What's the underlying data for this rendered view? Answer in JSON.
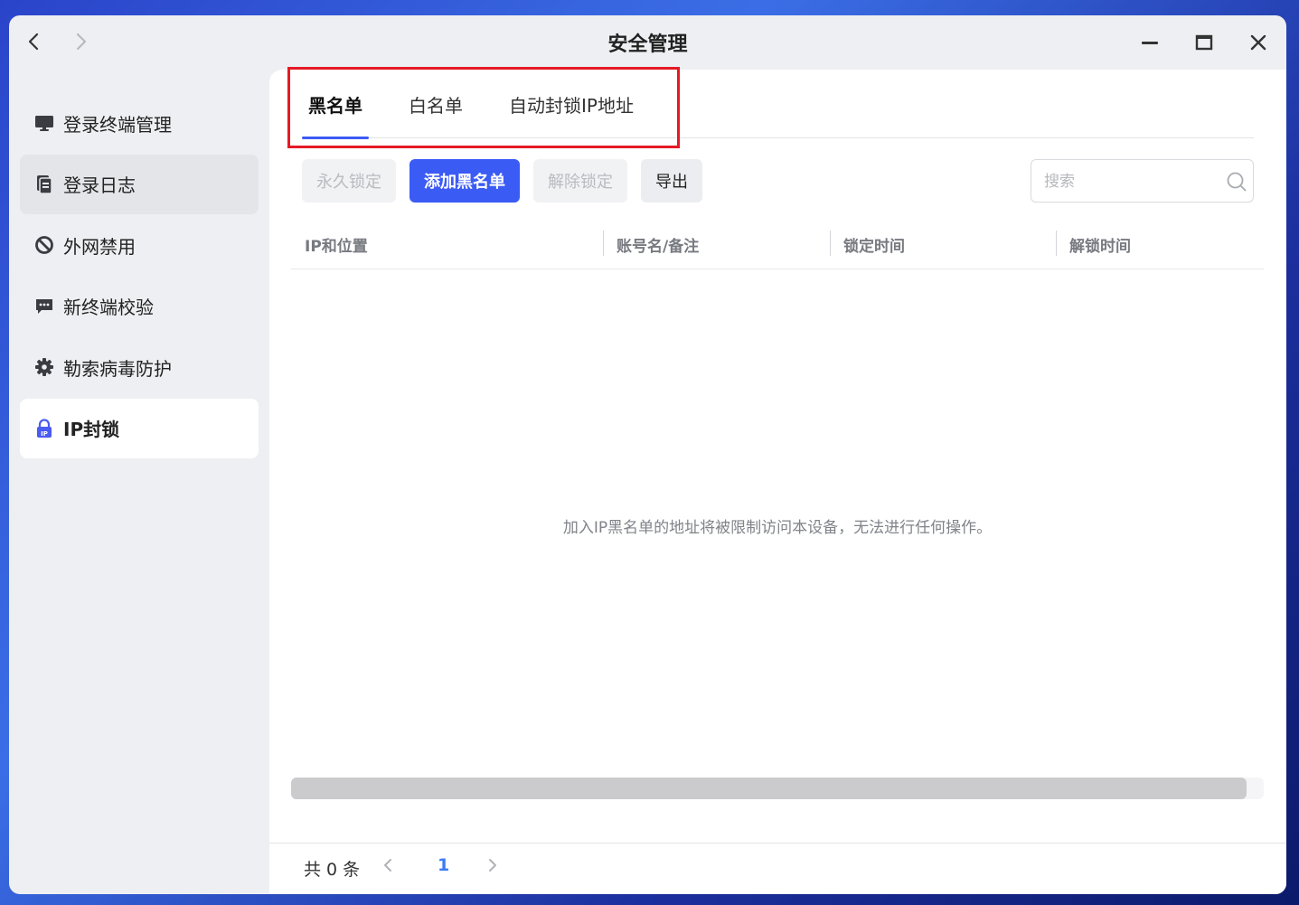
{
  "window": {
    "title": "安全管理",
    "back_icon": "chevron-left-icon",
    "forward_icon": "chevron-right-icon",
    "controls": [
      "minimize-icon",
      "maximize-icon",
      "close-icon"
    ]
  },
  "sidebar": {
    "items": [
      {
        "label": "登录终端管理",
        "icon": "monitor-icon",
        "state": "normal"
      },
      {
        "label": "登录日志",
        "icon": "document-icon",
        "state": "hover"
      },
      {
        "label": "外网禁用",
        "icon": "ban-icon",
        "state": "normal"
      },
      {
        "label": "新终端校验",
        "icon": "chat-icon",
        "state": "normal"
      },
      {
        "label": "勒索病毒防护",
        "icon": "gear-icon",
        "state": "normal"
      },
      {
        "label": "IP封锁",
        "icon": "ip-lock-icon",
        "state": "active"
      }
    ]
  },
  "tabs": [
    {
      "label": "黑名单",
      "active": true
    },
    {
      "label": "白名单",
      "active": false
    },
    {
      "label": "自动封锁IP地址",
      "active": false
    }
  ],
  "toolbar": {
    "permanent_lock": "永久锁定",
    "add_blacklist": "添加黑名单",
    "unlock": "解除锁定",
    "export": "导出",
    "search_placeholder": "搜索"
  },
  "table": {
    "columns": [
      "IP和位置",
      "账号名/备注",
      "锁定时间",
      "解锁时间"
    ],
    "rows": [],
    "empty_message": "加入IP黑名单的地址将被限制访问本设备，无法进行任何操作。"
  },
  "pagination": {
    "total_label": "共 0 条",
    "current_page": "1"
  },
  "colors": {
    "accent": "#3b5bf5",
    "highlight_border": "#e51a24",
    "page_number": "#3b7cf5"
  }
}
